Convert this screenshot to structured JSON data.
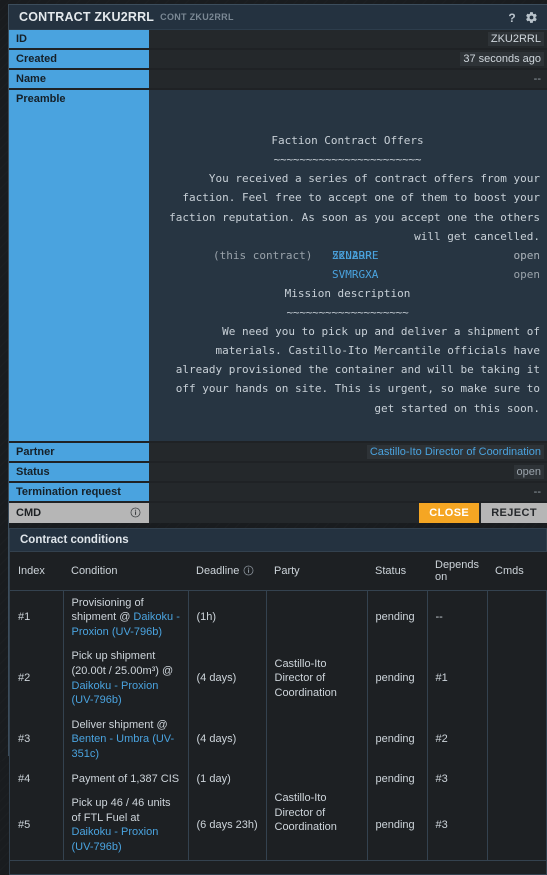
{
  "window": {
    "title": "CONTRACT ZKU2RRL",
    "subtitle": "CONT ZKU2RRL",
    "help_icon": "question-mark-icon",
    "settings_icon": "gear-icon"
  },
  "properties": [
    {
      "label": "ID",
      "value": "ZKU2RRL",
      "style": "chip"
    },
    {
      "label": "Created",
      "value": "37 seconds ago",
      "style": "chip"
    },
    {
      "label": "Name",
      "value": "--",
      "style": "dash"
    },
    {
      "label": "Preamble",
      "value": "",
      "style": "preamble"
    },
    {
      "label": "Partner",
      "value": "Castillo-Ito Director of Coordination",
      "style": "link"
    },
    {
      "label": "Status",
      "value": "open",
      "style": "muted"
    },
    {
      "label": "Termination request",
      "value": "--",
      "style": "dash"
    }
  ],
  "preamble": {
    "heading": "Faction Contract Offers",
    "heading_rule": "~~~~~~~~~~~~~~~~~~~~~~~",
    "body_lines": [
      "You received a series of contract offers from your",
      "faction. Feel free to accept one of them to boost your",
      "faction reputation. As soon as you accept one the others",
      "will get cancelled."
    ],
    "offers": [
      {
        "note": "",
        "id": "52NA9PF",
        "status": "open"
      },
      {
        "note": "(this contract)",
        "id": "ZKU2RRL",
        "status": "open"
      },
      {
        "note": "",
        "id": "SVMRGXA",
        "status": "open"
      }
    ],
    "mission_heading": "Mission description",
    "mission_rule": "~~~~~~~~~~~~~~~~~~~",
    "mission_lines": [
      "We need you to pick up and deliver a shipment of",
      "materials. Castillo-Ito Mercantile officials have",
      "already provisioned the container and will be taking it",
      "off your hands on site. This is urgent, so make sure to",
      "get started on this soon."
    ]
  },
  "cmd": {
    "label": "CMD",
    "info_icon": "info-icon",
    "close_label": "CLOSE",
    "reject_label": "REJECT"
  },
  "conditions": {
    "panel_title": "Contract conditions",
    "columns": [
      "Index",
      "Condition",
      "Deadline",
      "Party",
      "Status",
      "Depends on",
      "Cmds"
    ],
    "deadline_info_icon": "info-icon",
    "rows": [
      {
        "index": "#1",
        "condition_pre": "Provisioning of shipment @ ",
        "condition_link": "Daikoku - Proxion (UV-796b)",
        "condition_post": "",
        "deadline": "(1h)",
        "party": "Castillo-Ito Director of Coordination",
        "party_rowspan": 3,
        "status": "pending",
        "depends_on": "--",
        "cmds": ""
      },
      {
        "index": "#2",
        "condition_pre": "Pick up shipment (20.00t / 25.00m³) @ ",
        "condition_link": "Daikoku - Proxion (UV-796b)",
        "condition_post": "",
        "deadline": "(4 days)",
        "party": "",
        "status": "pending",
        "depends_on": "#1",
        "cmds": ""
      },
      {
        "index": "#3",
        "condition_pre": "Deliver shipment @ ",
        "condition_link": "Benten - Umbra (UV-351c)",
        "condition_post": "",
        "deadline": "(4 days)",
        "party": "",
        "status": "pending",
        "depends_on": "#2",
        "cmds": ""
      },
      {
        "index": "#4",
        "condition_pre": "Payment of 1,387 CIS",
        "condition_link": "",
        "condition_post": "",
        "deadline": "(1 day)",
        "party": "Castillo-Ito Director of Coordination",
        "party_rowspan": 2,
        "status": "pending",
        "depends_on": "#3",
        "cmds": ""
      },
      {
        "index": "#5",
        "condition_pre": "Pick up 46 / 46 units of FTL Fuel at ",
        "condition_link": "Daikoku - Proxion (UV-796b)",
        "condition_post": "",
        "deadline": "(6 days 23h)",
        "party": "",
        "status": "pending",
        "depends_on": "#3",
        "cmds": ""
      }
    ]
  },
  "colors": {
    "accent_blue": "#4aa3df",
    "panel_header": "#243240",
    "close_button": "#f5a623",
    "reject_button": "#b6b6b6",
    "status_pending": "#d4606a",
    "muted_text": "#8d969e"
  }
}
